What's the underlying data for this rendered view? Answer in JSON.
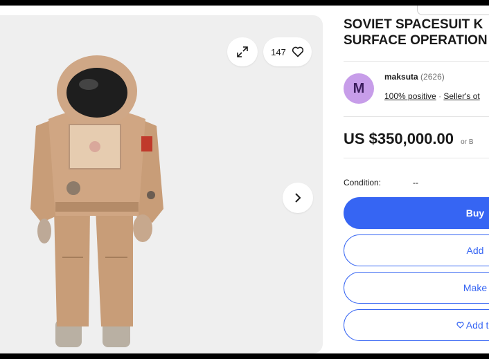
{
  "listing": {
    "title_line1": "SOVIET SPACESUIT K",
    "title_line2": "SURFACE OPERATION",
    "watch_count": "147"
  },
  "seller": {
    "initial": "M",
    "name": "maksuta",
    "count": "(2626)",
    "positive": "100% positive",
    "other_link": "Seller's ot"
  },
  "price": {
    "amount": "US $350,000.00",
    "suffix": "or B"
  },
  "condition": {
    "label": "Condition:",
    "value": "--"
  },
  "buttons": {
    "buy": "Buy",
    "add_cart": "Add",
    "offer": "Make",
    "watchlist": "Add to"
  },
  "icons": {
    "expand": "expand-icon",
    "heart": "heart-icon",
    "next": "chevron-right-icon"
  },
  "colors": {
    "primary": "#3665f3",
    "avatar": "#c79de9"
  }
}
